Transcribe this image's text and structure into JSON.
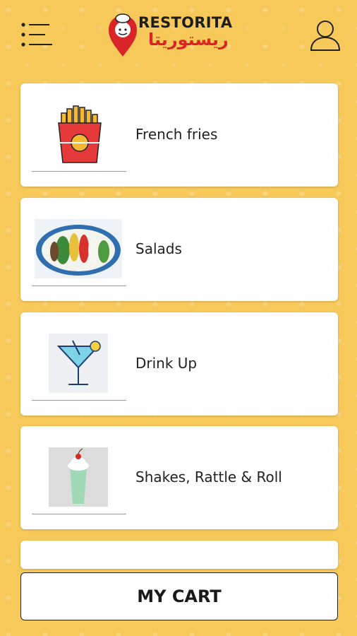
{
  "app": {
    "brand_name": "RESTORITA",
    "brand_name_arabic": "ريستوريتا"
  },
  "header": {
    "menu_icon": "hamburger-menu-icon",
    "user_icon": "user-profile-icon"
  },
  "categories": [
    {
      "label": "French fries",
      "icon": "french-fries-icon"
    },
    {
      "label": "Salads",
      "icon": "salad-image"
    },
    {
      "label": "Drink Up",
      "icon": "cocktail-icon"
    },
    {
      "label": "Shakes, Rattle & Roll",
      "icon": "milkshake-image"
    }
  ],
  "footer": {
    "cart_label": "MY CART"
  },
  "colors": {
    "background": "#f6c95a",
    "brand_red": "#d92527",
    "card": "#ffffff"
  }
}
